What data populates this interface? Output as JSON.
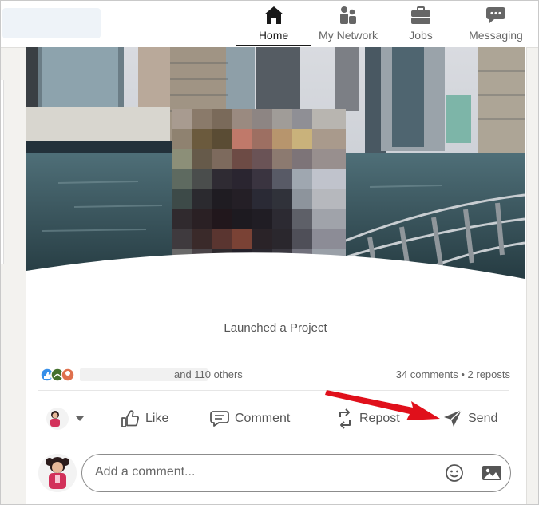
{
  "nav": {
    "items": [
      {
        "label": "Home",
        "icon": "home-icon",
        "active": true
      },
      {
        "label": "My Network",
        "icon": "network-icon",
        "active": false
      },
      {
        "label": "Jobs",
        "icon": "briefcase-icon",
        "active": false
      },
      {
        "label": "Messaging",
        "icon": "messaging-icon",
        "active": false
      }
    ]
  },
  "post": {
    "caption": "Launched a Project",
    "reactions_tail": "and 110 others",
    "counts": "34 comments • 2 reposts"
  },
  "actions": {
    "like": "Like",
    "comment": "Comment",
    "repost": "Repost",
    "send": "Send"
  },
  "comment": {
    "placeholder": "Add a comment..."
  },
  "colors": {
    "annotation_arrow": "#e0101b",
    "text_dark": "#191919",
    "text_muted": "#666666"
  }
}
